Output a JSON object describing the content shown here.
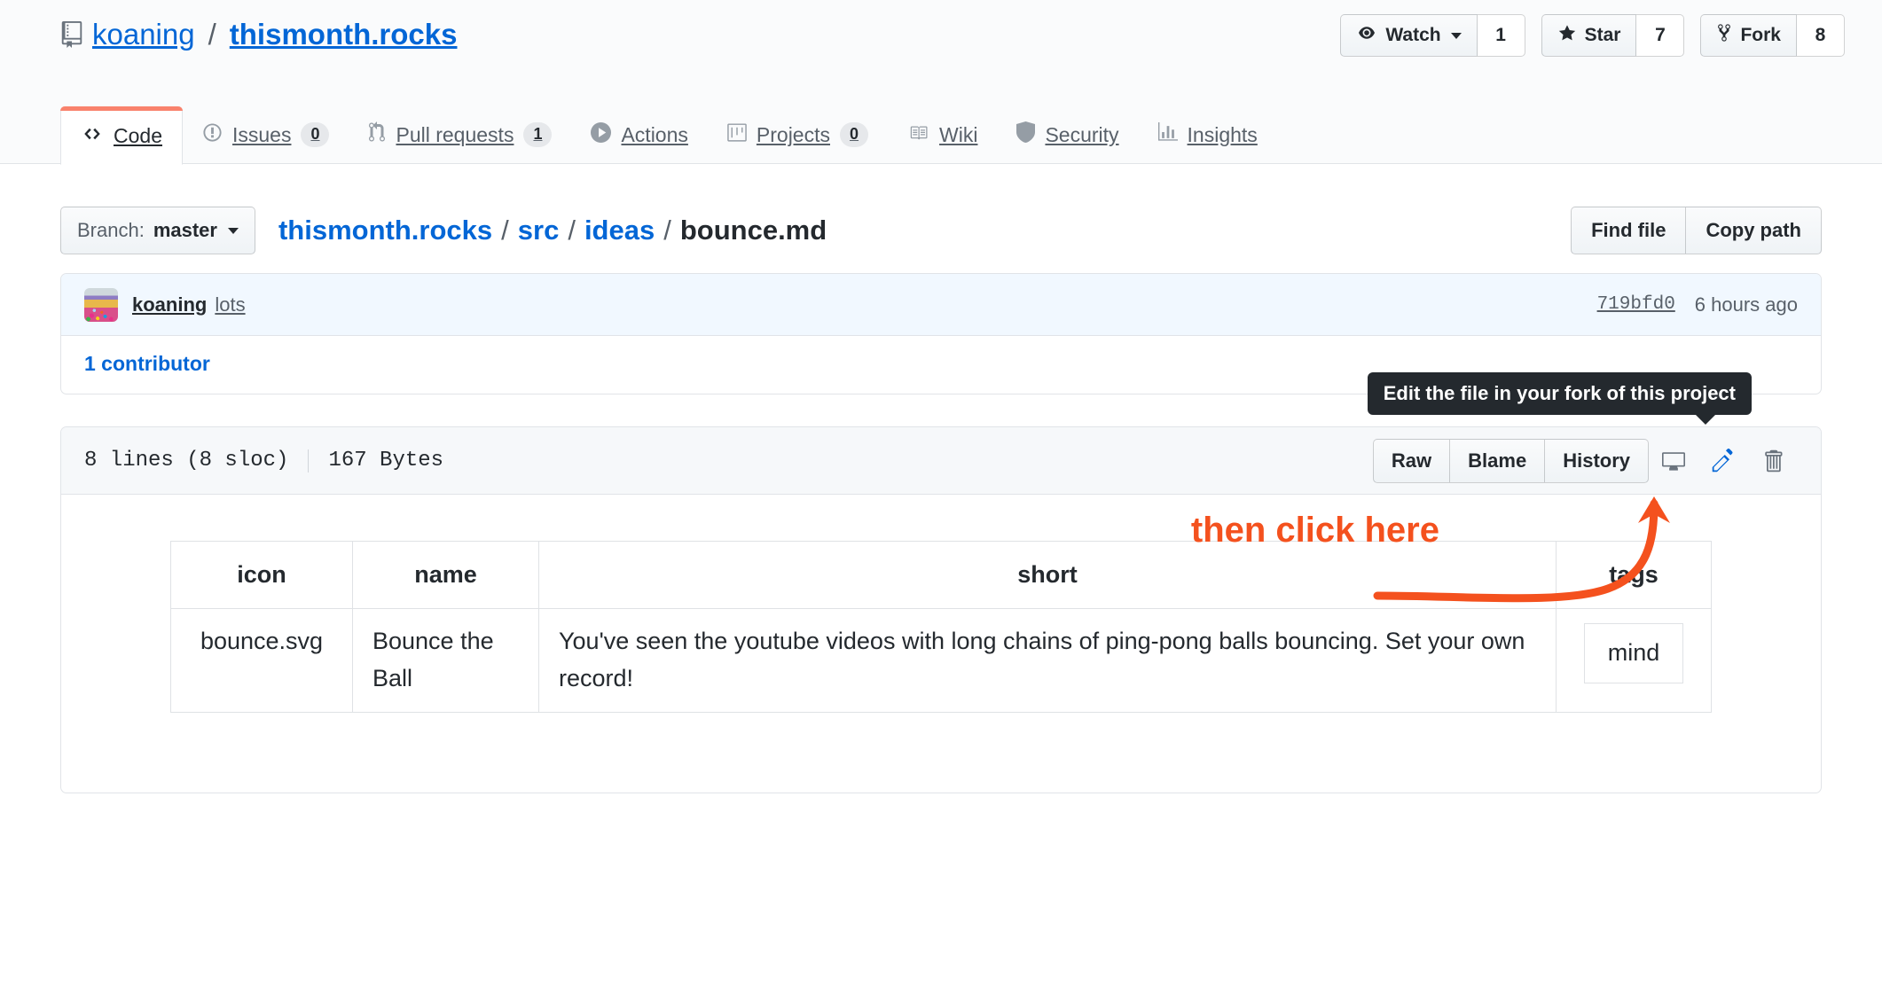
{
  "repo": {
    "owner": "koaning",
    "separator": "/",
    "name": "thismonth.rocks",
    "icon": "repo-icon"
  },
  "social": [
    {
      "label": "Watch",
      "count": "1",
      "icon": "eye-icon",
      "has_caret": true
    },
    {
      "label": "Star",
      "count": "7",
      "icon": "star-icon",
      "has_caret": false
    },
    {
      "label": "Fork",
      "count": "8",
      "icon": "repo-forked-icon",
      "has_caret": false
    }
  ],
  "nav_tabs": [
    {
      "label": "Code",
      "icon": "code-icon",
      "counter": "",
      "active": true
    },
    {
      "label": "Issues",
      "icon": "issue-opened-icon",
      "counter": "0",
      "active": false
    },
    {
      "label": "Pull requests",
      "icon": "git-pull-request-icon",
      "counter": "1",
      "active": false
    },
    {
      "label": "Actions",
      "icon": "play-icon",
      "counter": "",
      "active": false
    },
    {
      "label": "Projects",
      "icon": "project-icon",
      "counter": "0",
      "active": false
    },
    {
      "label": "Wiki",
      "icon": "book-icon",
      "counter": "",
      "active": false
    },
    {
      "label": "Security",
      "icon": "shield-icon",
      "counter": "",
      "active": false
    },
    {
      "label": "Insights",
      "icon": "graph-icon",
      "counter": "",
      "active": false
    }
  ],
  "file_nav": {
    "branch_label": "Branch:",
    "branch_value": "master",
    "breadcrumb": [
      {
        "text": "thismonth.rocks",
        "link": true
      },
      {
        "text": "src",
        "link": true
      },
      {
        "text": "ideas",
        "link": true
      },
      {
        "text": "bounce.md",
        "link": false
      }
    ],
    "find_file": "Find file",
    "copy_path": "Copy path"
  },
  "commit": {
    "author": "koaning",
    "message": "lots",
    "sha": "719bfd0",
    "time": "6 hours ago",
    "contributors": "1 contributor"
  },
  "file": {
    "lines": "8 lines (8 sloc)",
    "size": "167 Bytes",
    "raw": "Raw",
    "blame": "Blame",
    "history": "History",
    "desktop_icon": "desktop-download-icon",
    "edit_icon": "pencil-icon",
    "delete_icon": "trash-icon"
  },
  "tooltip": {
    "text": "Edit the file in your fork of this project"
  },
  "annotation": {
    "text": "then click here",
    "color": "#f4511e"
  },
  "markdown_table": {
    "headers": [
      "icon",
      "name",
      "short",
      "tags"
    ],
    "rows": [
      {
        "icon": "bounce.svg",
        "name": "Bounce the Ball",
        "short": "You've seen the youtube videos with long chains of ping-pong balls bouncing. Set your own record!",
        "tags": [
          "mind"
        ]
      }
    ]
  },
  "colors": {
    "accent_blue": "#0366d6",
    "active_tab_border": "#f9826c",
    "commit_bg": "#f1f8ff",
    "header_bg": "#fafbfc",
    "border": "#e1e4e8"
  }
}
